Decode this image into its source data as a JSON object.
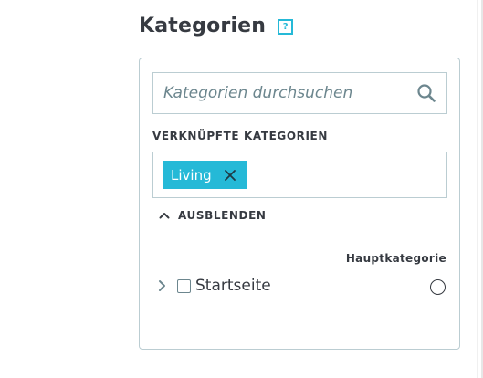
{
  "header": {
    "title": "Kategorien",
    "help_label": "?"
  },
  "search": {
    "placeholder": "Kategorien durchsuchen",
    "value": ""
  },
  "linked": {
    "label": "VERKNÜPFTE KATEGORIEN",
    "tags": [
      {
        "label": "Living"
      }
    ]
  },
  "toggle": {
    "label": "AUSBLENDEN"
  },
  "tree": {
    "main_category_header": "Hauptkategorie",
    "nodes": [
      {
        "label": "Startseite",
        "checked": false,
        "is_main": false
      }
    ]
  },
  "colors": {
    "accent": "#25b9d7",
    "border": "#bbcdd2",
    "text": "#363a41",
    "muted": "#6c868e"
  }
}
